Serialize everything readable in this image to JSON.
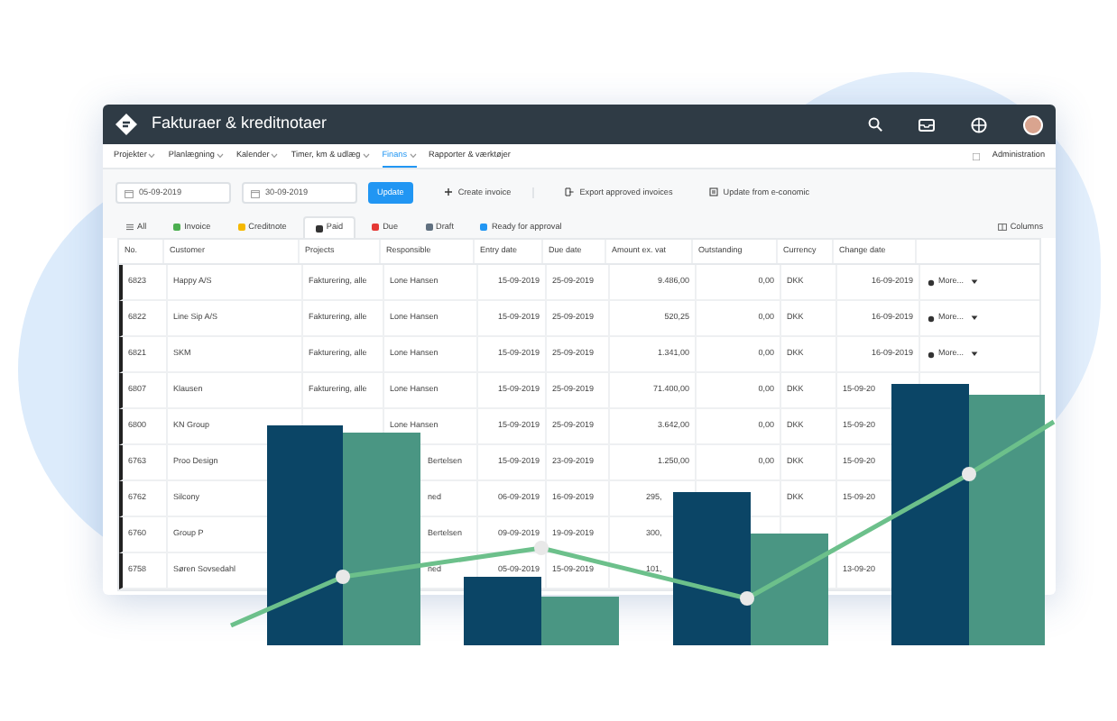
{
  "window": {
    "title": "Fakturaer & kreditnotaer"
  },
  "nav": {
    "items": [
      {
        "label": "Projekter",
        "selected": false
      },
      {
        "label": "Planlægning",
        "selected": false
      },
      {
        "label": "Kalender",
        "selected": false
      },
      {
        "label": "Timer, km & udlæg",
        "selected": false
      },
      {
        "label": "Finans",
        "selected": true
      },
      {
        "label": "Rapporter & værktøjer",
        "selected": false
      }
    ],
    "admin": "Administration"
  },
  "toolbar": {
    "date_from": "05-09-2019",
    "date_to": "30-09-2019",
    "update": "Update",
    "actions": [
      "Create invoice",
      "Export approved invoices",
      "Update from e-conomic"
    ]
  },
  "filters": {
    "items": [
      {
        "label": "All",
        "selected": false
      },
      {
        "label": "Invoice",
        "selected": false,
        "color": "#4caf50"
      },
      {
        "label": "Creditnote",
        "selected": false,
        "color": "#f5b800"
      },
      {
        "label": "Paid",
        "selected": true,
        "color": "#333333"
      },
      {
        "label": "Due",
        "selected": false,
        "color": "#e53935"
      },
      {
        "label": "Draft",
        "selected": false,
        "color": "#607080"
      },
      {
        "label": "Ready for approval",
        "selected": false,
        "color": "#2196f3"
      }
    ],
    "columns": "Columns"
  },
  "table": {
    "columns": [
      "No.",
      "Customer",
      "Projects",
      "Responsible",
      "Entry date",
      "Due date",
      "Amount ex. vat",
      "Outstanding",
      "Currency",
      "Change date"
    ],
    "rows": [
      {
        "cells": [
          "6823",
          "Happy A/S",
          "Fakturering, alle",
          "Lone Hansen",
          "15-09-2019",
          "25-09-2019",
          "9.486,00",
          "0,00",
          "DKK",
          "16-09-2019"
        ],
        "action": "More..."
      },
      {
        "cells": [
          "6822",
          "Line Sip A/S",
          "Fakturering, alle",
          "Lone Hansen",
          "15-09-2019",
          "25-09-2019",
          "520,25",
          "0,00",
          "DKK",
          "16-09-2019"
        ],
        "action": "More..."
      },
      {
        "cells": [
          "6821",
          "SKM",
          "Fakturering, alle",
          "Lone Hansen",
          "15-09-2019",
          "25-09-2019",
          "1.341,00",
          "0,00",
          "DKK",
          "16-09-2019"
        ],
        "action": "More..."
      },
      {
        "cells": [
          "6807",
          "Klausen",
          "Fakturering, alle",
          "Lone Hansen",
          "15-09-2019",
          "25-09-2019",
          "71.400,00",
          "0,00",
          "DKK",
          "15-09-20"
        ],
        "action": null
      },
      {
        "cells": [
          "6800",
          "KN Group",
          null,
          "Lone Hansen",
          "15-09-2019",
          "25-09-2019",
          "3.642,00",
          "0,00",
          "DKK",
          "15-09-20"
        ],
        "action": null
      },
      {
        "cells": [
          "6763",
          "Proo Design",
          null,
          "Bertelsen",
          "15-09-2019",
          "23-09-2019",
          "1.250,00",
          "0,00",
          "DKK",
          "15-09-20"
        ],
        "action": null
      },
      {
        "cells": [
          "6762",
          "Silcony",
          null,
          "ned",
          "06-09-2019",
          "16-09-2019",
          "295,",
          null,
          "DKK",
          "15-09-20"
        ],
        "action": null
      },
      {
        "cells": [
          "6760",
          "Group P",
          null,
          "Bertelsen",
          "09-09-2019",
          "19-09-2019",
          "300,",
          null,
          null,
          null
        ],
        "action": null
      },
      {
        "cells": [
          "6758",
          "Søren Sovsedahl",
          null,
          "ned",
          "05-09-2019",
          "15-09-2019",
          "101,",
          null,
          null,
          "13-09-20"
        ],
        "action": null
      }
    ]
  }
}
